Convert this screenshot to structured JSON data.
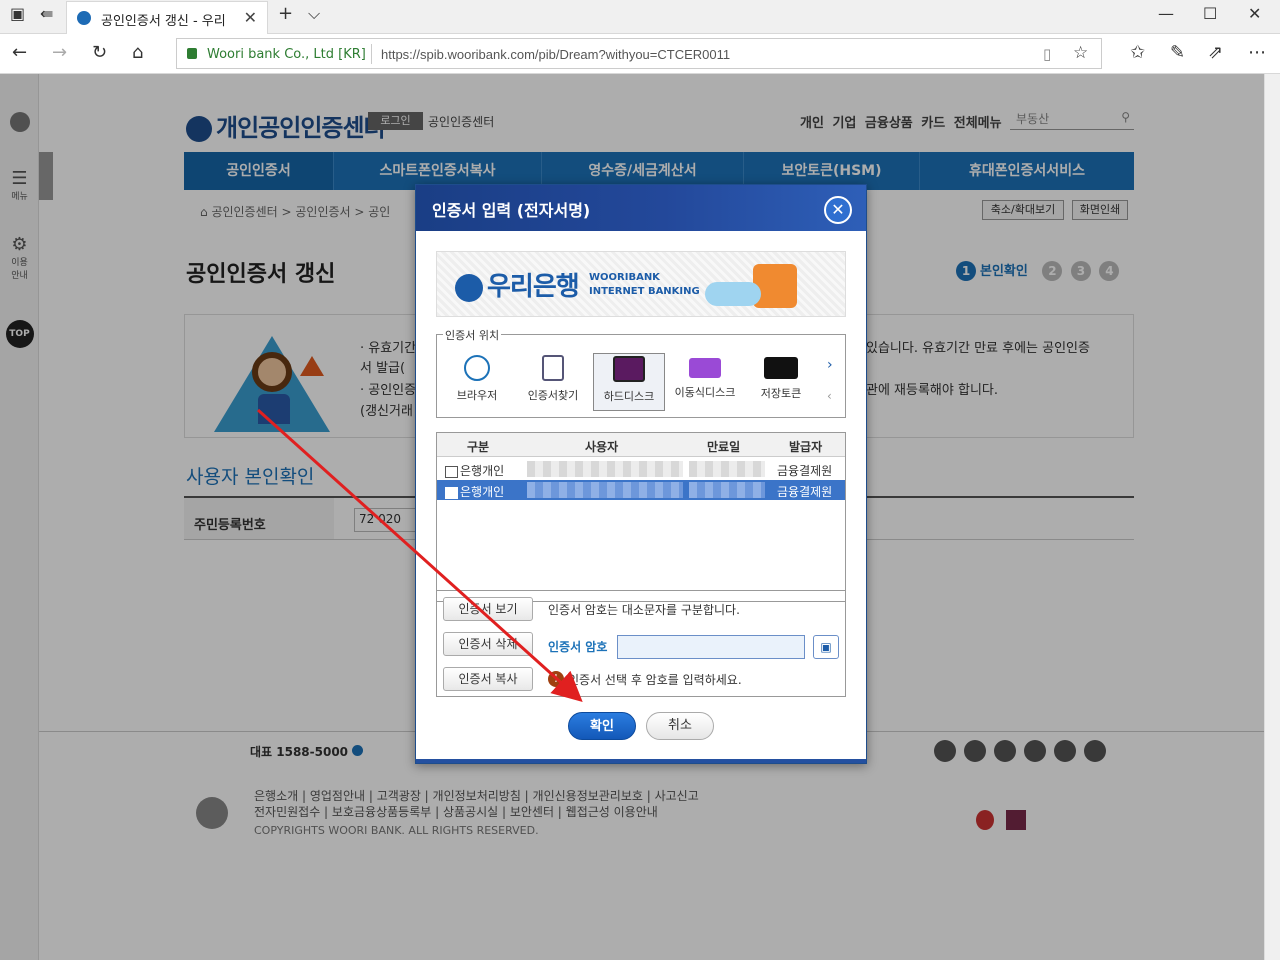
{
  "browser": {
    "tab_title": "공인인증서 갱신 - 우리",
    "site_identity": "Woori bank Co., Ltd [KR]",
    "url": "https://spib.wooribank.com/pib/Dream?withyou=CTCER0011"
  },
  "page": {
    "logo": "개인공인인증센터",
    "login_button": "로그인",
    "cert_center": "공인인증센터",
    "top_menu": [
      "개인",
      "기업",
      "금융상품",
      "카드",
      "전체메뉴"
    ],
    "search_placeholder": "부동산",
    "gnb": [
      "공인인증서",
      "스마트폰인증서복사",
      "영수증/세금계산서",
      "보안토큰(HSM)",
      "휴대폰인증서서비스"
    ],
    "breadcrumb": "공인인증센터 > 공인인증서 > 공인",
    "zoom_button": "축소/확대보기",
    "print_button": "화면인쇄",
    "title": "공인인증서 갱신",
    "steps": {
      "current_num": "1",
      "current_label": "본인확인",
      "others": [
        "2",
        "3",
        "4"
      ]
    },
    "info_left": [
      "· 유효기간",
      "서 발급(",
      "· 공인인증",
      "(갱신거래"
    ],
    "info_right": [
      "있습니다. 유효기간 만료 후에는 공인인증",
      "관에 재등록해야 합니다."
    ],
    "section_title": "사용자 본인확인",
    "id_label": "주민등록번호",
    "id_value": "72 020",
    "tel": "대표 1588-5000",
    "footer_links1": "은행소개 | 영업점안내 | 고객광장 | 개인정보처리방침 | 개인신용정보관리보호 | 사고신고",
    "footer_links2": "전자민원접수 | 보호금융상품등록부 | 상품공시실 | 보안센터 | 웹접근성 이용안내",
    "copyright": "COPYRIGHTS WOORI BANK. ALL RIGHTS RESERVED."
  },
  "sidebar": {
    "menu": "메뉴",
    "usage": "이용\n안내",
    "top": "TOP"
  },
  "dialog": {
    "title": "인증서 입력 (전자서명)",
    "banner_logo": "우리은행",
    "banner_sub1": "WOORIBANK",
    "banner_sub2": "INTERNET BANKING",
    "location_legend": "인증서 위치",
    "locations": [
      "브라우저",
      "인증서찾기",
      "하드디스크",
      "이동식디스크",
      "저장토큰"
    ],
    "table_headers": [
      "구분",
      "사용자",
      "만료일",
      "발급자"
    ],
    "rows": [
      {
        "type": "은행개인",
        "issuer": "금융결제원"
      },
      {
        "type": "은행개인",
        "issuer": "금융결제원"
      }
    ],
    "btn_view": "인증서 보기",
    "btn_delete": "인증서 삭제",
    "btn_copy": "인증서 복사",
    "case_note": "인증서 암호는 대소문자를 구분합니다.",
    "password_label": "인증서 암호",
    "warning": "인증서 선택 후 암호를 입력하세요.",
    "ok": "확인",
    "cancel": "취소"
  },
  "colors": {
    "brand": "#1c72b8",
    "dialog_header": "#1a3e85",
    "selected_row": "#3b74c8",
    "annotation_arrow": "#e02020"
  }
}
